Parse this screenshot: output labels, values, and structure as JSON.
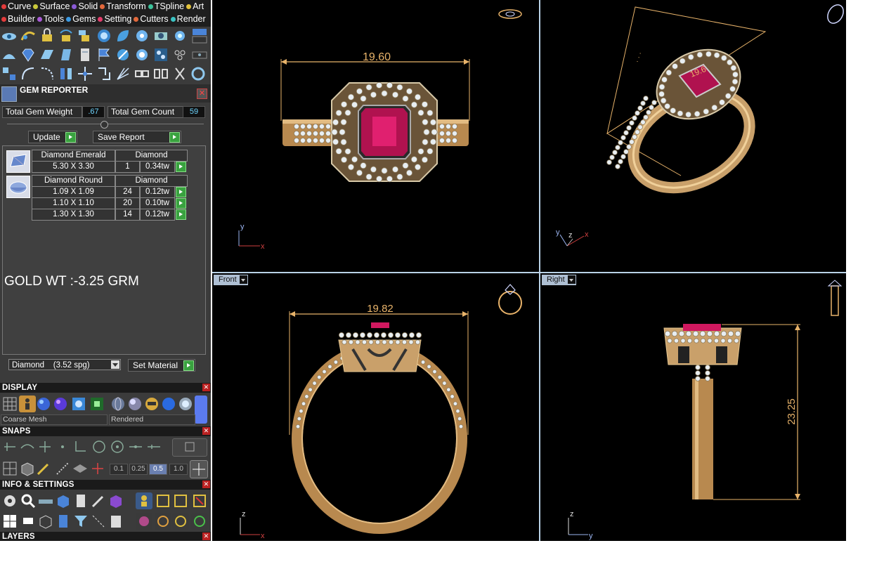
{
  "menu": {
    "row1": [
      {
        "label": "Curve",
        "color": "#e23b3b"
      },
      {
        "label": "Surface",
        "color": "#c8c83a"
      },
      {
        "label": "Solid",
        "color": "#8a5ad6"
      },
      {
        "label": "Transform",
        "color": "#e2683b"
      },
      {
        "label": "TSpline",
        "color": "#3bc29a"
      },
      {
        "label": "Art",
        "color": "#e2c23b"
      }
    ],
    "row2": [
      {
        "label": "Builder",
        "color": "#e23b3b"
      },
      {
        "label": "Tools",
        "color": "#a85ad6"
      },
      {
        "label": "Gems",
        "color": "#3b9ae2"
      },
      {
        "label": "Setting",
        "color": "#e23b6a"
      },
      {
        "label": "Cutters",
        "color": "#e2683b"
      },
      {
        "label": "Render",
        "color": "#3bc2c2"
      }
    ]
  },
  "gem_reporter": {
    "title": "GEM REPORTER",
    "total_weight_label": "Total Gem Weight",
    "total_weight_value": ".67",
    "total_count_label": "Total Gem Count",
    "total_count_value": "59",
    "update_label": "Update",
    "save_report_label": "Save Report",
    "groups": [
      {
        "name": "Diamond Emerald",
        "material": "Diamond",
        "rows": [
          {
            "size": "5.30 X 3.30",
            "count": "1",
            "weight": "0.34tw"
          }
        ]
      },
      {
        "name": "Diamond Round",
        "material": "Diamond",
        "rows": [
          {
            "size": "1.09 X 1.09",
            "count": "24",
            "weight": "0.12tw"
          },
          {
            "size": "1.10 X 1.10",
            "count": "20",
            "weight": "0.10tw"
          },
          {
            "size": "1.30 X 1.30",
            "count": "14",
            "weight": "0.12tw"
          }
        ]
      }
    ],
    "gold_weight": "GOLD WT :-3.25 GRM",
    "material_select": "Diamond    (3.52 spg)",
    "set_material_label": "Set Material"
  },
  "panels": {
    "display": "DISPLAY",
    "snaps": "SNAPS",
    "info_settings": "INFO & SETTINGS",
    "layers": "LAYERS"
  },
  "display": {
    "mesh_option": "Coarse Mesh",
    "render_option": "Rendered"
  },
  "snaps": {
    "steps": [
      "0.1",
      "0.25",
      "0.5",
      "1.0"
    ],
    "active_step": "0.5"
  },
  "viewports": {
    "top": {
      "dimension": "19.60",
      "axis_a": "y",
      "axis_b": "x"
    },
    "perspective": {
      "dimension": "19.6",
      "axis_a": "y",
      "axis_b": "z",
      "axis_c": "x"
    },
    "front": {
      "label": "Front",
      "dimension": "19.82",
      "axis_a": "z",
      "axis_b": "x"
    },
    "right": {
      "label": "Right",
      "dimension": "23.25",
      "axis_a": "z",
      "axis_b": "y"
    }
  },
  "colors": {
    "accent_blue": "#6fd6ff",
    "gold": "#c9a06a",
    "dimension": "#e8b36a",
    "ruby": "#d0185f",
    "go_green": "#39a23f"
  }
}
